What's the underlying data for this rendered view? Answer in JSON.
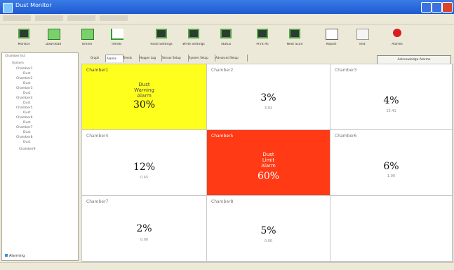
{
  "window": {
    "title": "Dust Monitor"
  },
  "menu": {
    "items": [
      "File",
      "View",
      "Tools",
      "Help"
    ]
  },
  "toolbar": {
    "items": [
      {
        "label": "Monitor",
        "icon": "monitor-icon"
      },
      {
        "label": "Download",
        "icon": "download-icon"
      },
      {
        "label": "Online",
        "icon": "online-icon"
      },
      {
        "label": "Trends",
        "icon": "trend-chart-icon"
      },
      {
        "label": "Read Settings",
        "icon": "read-settings-icon"
      },
      {
        "label": "Write Settings",
        "icon": "write-settings-icon"
      },
      {
        "label": "Status",
        "icon": "status-icon"
      },
      {
        "label": "Print All",
        "icon": "print-all-icon"
      },
      {
        "label": "Next Scan",
        "icon": "next-scan-icon"
      },
      {
        "label": "Report",
        "icon": "report-icon"
      },
      {
        "label": "Text",
        "icon": "text-icon"
      },
      {
        "label": "Alarms",
        "icon": "alarm-icon"
      }
    ]
  },
  "tabs": [
    "Graph",
    "Alarms",
    "Trends",
    "Hopper Log",
    "Sensor Setup",
    "System Setup",
    "Advanced Setup"
  ],
  "ack_button": "Acknowledge Alarms",
  "tree": {
    "header": "Chamber list",
    "nodes": [
      "System",
      "Chamber1",
      "Dust",
      "Chamber2",
      "Dust",
      "Chamber3",
      "Dust",
      "Chamber4",
      "Dust",
      "Chamber5",
      "Dust",
      "Chamber6",
      "Dust",
      "Chamber7",
      "Dust",
      "Chamber8",
      "Dust",
      "Chamber9"
    ],
    "bottom": "Alarming"
  },
  "cells": [
    {
      "name": "Chamber1",
      "pct": "30%",
      "alarm": [
        "Dust",
        "Warning",
        "Alarm"
      ],
      "sub": "",
      "state": "warning"
    },
    {
      "name": "Chamber2",
      "pct": "3%",
      "alarm": [],
      "sub": "3.91",
      "state": "normal"
    },
    {
      "name": "Chamber3",
      "pct": "4%",
      "alarm": [],
      "sub": "15.41",
      "state": "normal"
    },
    {
      "name": "Chamber4",
      "pct": "12%",
      "alarm": [],
      "sub": "0.45",
      "state": "normal"
    },
    {
      "name": "Chamber5",
      "pct": "60%",
      "alarm": [
        "Dust",
        "Limit",
        "Alarm"
      ],
      "sub": "",
      "state": "alarm"
    },
    {
      "name": "Chamber6",
      "pct": "6%",
      "alarm": [],
      "sub": "1.00",
      "state": "normal"
    },
    {
      "name": "Chamber7",
      "pct": "2%",
      "alarm": [],
      "sub": "0.00",
      "state": "normal"
    },
    {
      "name": "Chamber8",
      "pct": "5%",
      "alarm": [],
      "sub": "0.00",
      "state": "normal"
    },
    {
      "name": "",
      "pct": "",
      "alarm": [],
      "sub": "",
      "state": "empty"
    }
  ],
  "colors": {
    "warning": "#ffff1e",
    "alarm": "#ff3a14",
    "title_bar": "#2a6be0"
  }
}
